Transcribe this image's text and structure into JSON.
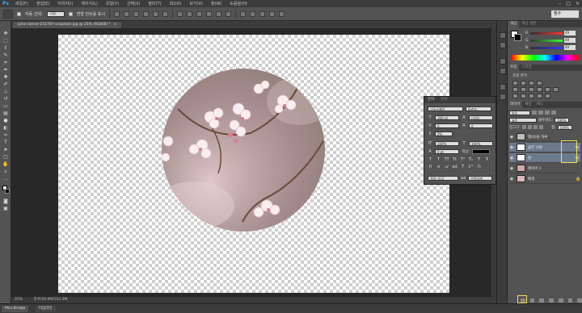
{
  "app": {
    "logo": "Ps"
  },
  "menu": [
    "파일(F)",
    "편집(E)",
    "이미지(I)",
    "레이어(L)",
    "유형(Y)",
    "선택(S)",
    "필터(T)",
    "3D(D)",
    "보기(V)",
    "창(W)",
    "도움말(H)"
  ],
  "window_controls": [
    "–",
    "□",
    "×"
  ],
  "options": {
    "auto_select_label": "자동 선택:",
    "auto_select_value": "그룹",
    "transform_label": "변형 컨트롤 표시",
    "workspace": "필수"
  },
  "document": {
    "tab_title": "julia-caesar-231787-unsplash.jpg @ 25% (RGB/8) *",
    "tab_close": "×",
    "zoom": "25%",
    "doc_info": "문서:93.9M/103.3M"
  },
  "bottom_tabs": [
    "Mini Bridge",
    "타임라인"
  ],
  "character_panel": {
    "tabs": [
      "문자",
      "단락"
    ],
    "font_family": "나눔스퀘어",
    "font_style": "Extra...",
    "size": "300 pt",
    "leading": "(자동)",
    "kerning": "0",
    "tracking": "0",
    "vscale_value": "0%",
    "scale_v": "100%",
    "scale_h": "100%",
    "baseline": "0 pt",
    "color_label": "색상:",
    "language": "영어: 미국",
    "antialias": "선명하게"
  },
  "color_panel": {
    "tabs": [
      "색상",
      "색상 견본"
    ],
    "rows": [
      {
        "label": "R",
        "value": "49"
      },
      {
        "label": "G",
        "value": "49"
      },
      {
        "label": "B",
        "value": "49"
      }
    ]
  },
  "adjust_panel": {
    "tabs": [
      "조정",
      "스타일"
    ],
    "label": "조정 추가"
  },
  "layers_panel": {
    "tabs": [
      "레이어",
      "채널",
      "패스"
    ],
    "filter_value": "종류",
    "blend_mode": "표준",
    "opacity_label": "불투명도:",
    "opacity_value": "100%",
    "lock_label": "잠그기:",
    "fill_label": "칠:",
    "fill_value": "100%",
    "layers": [
      {
        "name": "별(0)을 하루",
        "selected": false,
        "visible": true
      },
      {
        "name": "꽃은 사랑",
        "selected": true,
        "visible": true
      },
      {
        "name": "원",
        "selected": true,
        "visible": true
      },
      {
        "name": "레이어 1",
        "selected": false,
        "visible": true
      },
      {
        "name": "배경",
        "selected": false,
        "visible": true
      }
    ]
  },
  "colors": {
    "accent_highlight": "#f0e060",
    "ps_blue": "#31a8ff"
  }
}
